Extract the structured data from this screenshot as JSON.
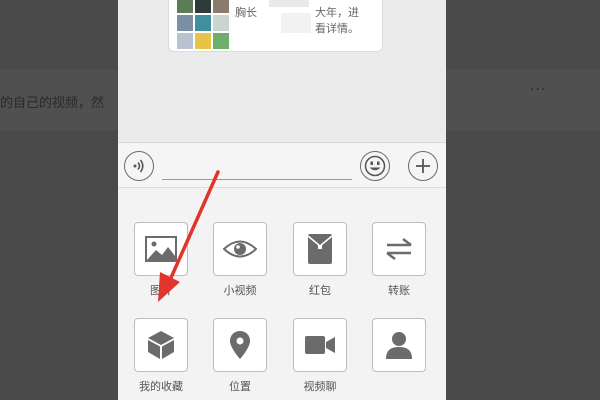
{
  "background": {
    "partial_text": "的自己的视频，然",
    "dots": "···"
  },
  "chat": {
    "bubble_lines": [
      "胸长",
      "大年，进",
      "看详情。"
    ]
  },
  "input_bar": {
    "voice_icon": "voice-icon",
    "emoji_icon": "emoji-icon",
    "plus_icon": "plus-icon"
  },
  "panel": {
    "row1": [
      {
        "label": "图片",
        "icon": "image-icon"
      },
      {
        "label": "小视频",
        "icon": "eye-icon"
      },
      {
        "label": "红包",
        "icon": "red-envelope-icon"
      },
      {
        "label": "转账",
        "icon": "transfer-icon"
      }
    ],
    "row2": [
      {
        "label": "我的收藏",
        "icon": "cube-icon"
      },
      {
        "label": "位置",
        "icon": "location-pin-icon"
      },
      {
        "label": "视频聊",
        "icon": "video-camera-icon"
      },
      {
        "label": "",
        "icon": "person-icon"
      }
    ]
  },
  "colors": {
    "arrow": "#e0342c",
    "icon_gray": "#6b6b6b"
  }
}
